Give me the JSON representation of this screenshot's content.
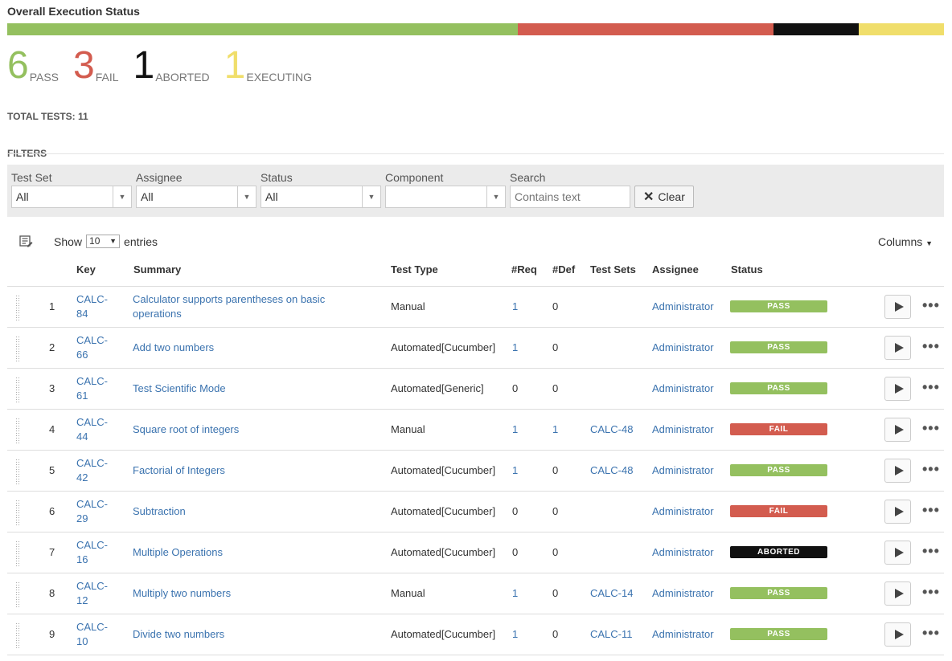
{
  "header": {
    "title": "Overall Execution Status"
  },
  "status_bar": [
    {
      "status": "PASS",
      "count": 6,
      "color": "#94c05f"
    },
    {
      "status": "FAIL",
      "count": 3,
      "color": "#d35c4f"
    },
    {
      "status": "ABORTED",
      "count": 1,
      "color": "#111111"
    },
    {
      "status": "EXECUTING",
      "count": 1,
      "color": "#f0de6b"
    }
  ],
  "counts": [
    {
      "num": "6",
      "label": "PASS",
      "color": "#94c05f"
    },
    {
      "num": "3",
      "label": "FAIL",
      "color": "#d35c4f"
    },
    {
      "num": "1",
      "label": "ABORTED",
      "color": "#111111"
    },
    {
      "num": "1",
      "label": "EXECUTING",
      "color": "#f0de6b"
    }
  ],
  "total_tests": "TOTAL TESTS: 11",
  "filters": {
    "heading": "FILTERS",
    "test_set": {
      "label": "Test Set",
      "value": "All"
    },
    "assignee": {
      "label": "Assignee",
      "value": "All"
    },
    "status": {
      "label": "Status",
      "value": "All"
    },
    "component": {
      "label": "Component",
      "value": ""
    },
    "search": {
      "label": "Search",
      "placeholder": "Contains text"
    },
    "clear_label": "Clear"
  },
  "table_controls": {
    "show_label": "Show",
    "length_value": "10",
    "entries_label": "entries",
    "columns_label": "Columns"
  },
  "columns": {
    "key": "Key",
    "summary": "Summary",
    "test_type": "Test Type",
    "req": "#Req",
    "def": "#Def",
    "test_sets": "Test Sets",
    "assignee": "Assignee",
    "status": "Status"
  },
  "status_colors": {
    "PASS": "#94c05f",
    "FAIL": "#d35c4f",
    "ABORTED": "#111111"
  },
  "rows": [
    {
      "n": "1",
      "key1": "CALC-",
      "key2": "84",
      "summary1": "Calculator supports parentheses on basic",
      "summary2": "operations",
      "type": "Manual",
      "req": "1",
      "req_link": true,
      "def": "0",
      "def_link": false,
      "sets": "",
      "assignee": "Administrator",
      "status": "PASS"
    },
    {
      "n": "2",
      "key1": "CALC-",
      "key2": "66",
      "summary1": "Add two numbers",
      "summary2": "",
      "type": "Automated[Cucumber]",
      "req": "1",
      "req_link": true,
      "def": "0",
      "def_link": false,
      "sets": "",
      "assignee": "Administrator",
      "status": "PASS"
    },
    {
      "n": "3",
      "key1": "CALC-",
      "key2": "61",
      "summary1": "Test Scientific Mode",
      "summary2": "",
      "type": "Automated[Generic]",
      "req": "0",
      "req_link": false,
      "def": "0",
      "def_link": false,
      "sets": "",
      "assignee": "Administrator",
      "status": "PASS"
    },
    {
      "n": "4",
      "key1": "CALC-",
      "key2": "44",
      "summary1": "Square root of integers",
      "summary2": "",
      "type": "Manual",
      "req": "1",
      "req_link": true,
      "def": "1",
      "def_link": true,
      "sets": "CALC-48",
      "assignee": "Administrator",
      "status": "FAIL"
    },
    {
      "n": "5",
      "key1": "CALC-",
      "key2": "42",
      "summary1": "Factorial of Integers",
      "summary2": "",
      "type": "Automated[Cucumber]",
      "req": "1",
      "req_link": true,
      "def": "0",
      "def_link": false,
      "sets": "CALC-48",
      "assignee": "Administrator",
      "status": "PASS"
    },
    {
      "n": "6",
      "key1": "CALC-",
      "key2": "29",
      "summary1": "Subtraction",
      "summary2": "",
      "type": "Automated[Cucumber]",
      "req": "0",
      "req_link": false,
      "def": "0",
      "def_link": false,
      "sets": "",
      "assignee": "Administrator",
      "status": "FAIL"
    },
    {
      "n": "7",
      "key1": "CALC-",
      "key2": "16",
      "summary1": "Multiple Operations",
      "summary2": "",
      "type": "Automated[Cucumber]",
      "req": "0",
      "req_link": false,
      "def": "0",
      "def_link": false,
      "sets": "",
      "assignee": "Administrator",
      "status": "ABORTED"
    },
    {
      "n": "8",
      "key1": "CALC-",
      "key2": "12",
      "summary1": "Multiply two numbers",
      "summary2": "",
      "type": "Manual",
      "req": "1",
      "req_link": true,
      "def": "0",
      "def_link": false,
      "sets": "CALC-14",
      "assignee": "Administrator",
      "status": "PASS"
    },
    {
      "n": "9",
      "key1": "CALC-",
      "key2": "10",
      "summary1": "Divide two numbers",
      "summary2": "",
      "type": "Automated[Cucumber]",
      "req": "1",
      "req_link": true,
      "def": "0",
      "def_link": false,
      "sets": "CALC-11",
      "assignee": "Administrator",
      "status": "PASS"
    }
  ]
}
